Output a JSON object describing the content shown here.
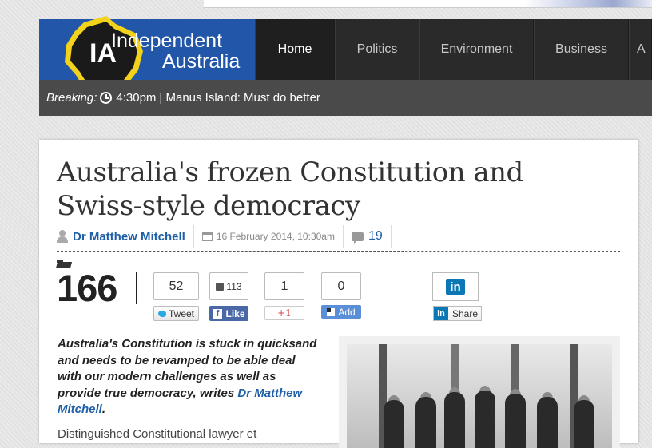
{
  "site": {
    "logo_text": "IA",
    "name_line1": "Independent",
    "name_line2": "Australia"
  },
  "nav": {
    "items": [
      {
        "label": "Home",
        "active": true
      },
      {
        "label": "Politics"
      },
      {
        "label": "Environment"
      },
      {
        "label": "Business"
      },
      {
        "label": "A"
      }
    ]
  },
  "breaking": {
    "label": "Breaking:",
    "time": "4:30pm",
    "text": "| Manus Island: Must do better"
  },
  "article": {
    "title": "Australia's frozen Constitution and Swiss-style democracy",
    "author": "Dr Matthew Mitchell",
    "date": "16 February 2014, 10:30am",
    "comment_count": "19",
    "share_total": "166",
    "lede_text": "Australia's Constitution is stuck in quicksand and needs to be revamped to be able deal with our modern challenges as well as provide true democracy, writes ",
    "lede_author_link": "Dr Matthew Mitchell",
    "lede_end": ".",
    "body_partial": "Distinguished Constitutional lawyer et"
  },
  "social": {
    "tweet_count": "52",
    "tweet_label": "Tweet",
    "like_count": "113",
    "like_label": "Like",
    "gplus_count": "1",
    "gplus_label": "+1",
    "add_count": "0",
    "add_label": "Add",
    "linkedin_logo": "in",
    "linkedin_label": "Share"
  },
  "colors": {
    "brand_blue": "#2156a8",
    "nav_bg": "#2a2a2a",
    "breaking_bg": "#4a4a4a",
    "link_blue": "#1f5fa8",
    "logo_yellow": "#f2d21b"
  }
}
